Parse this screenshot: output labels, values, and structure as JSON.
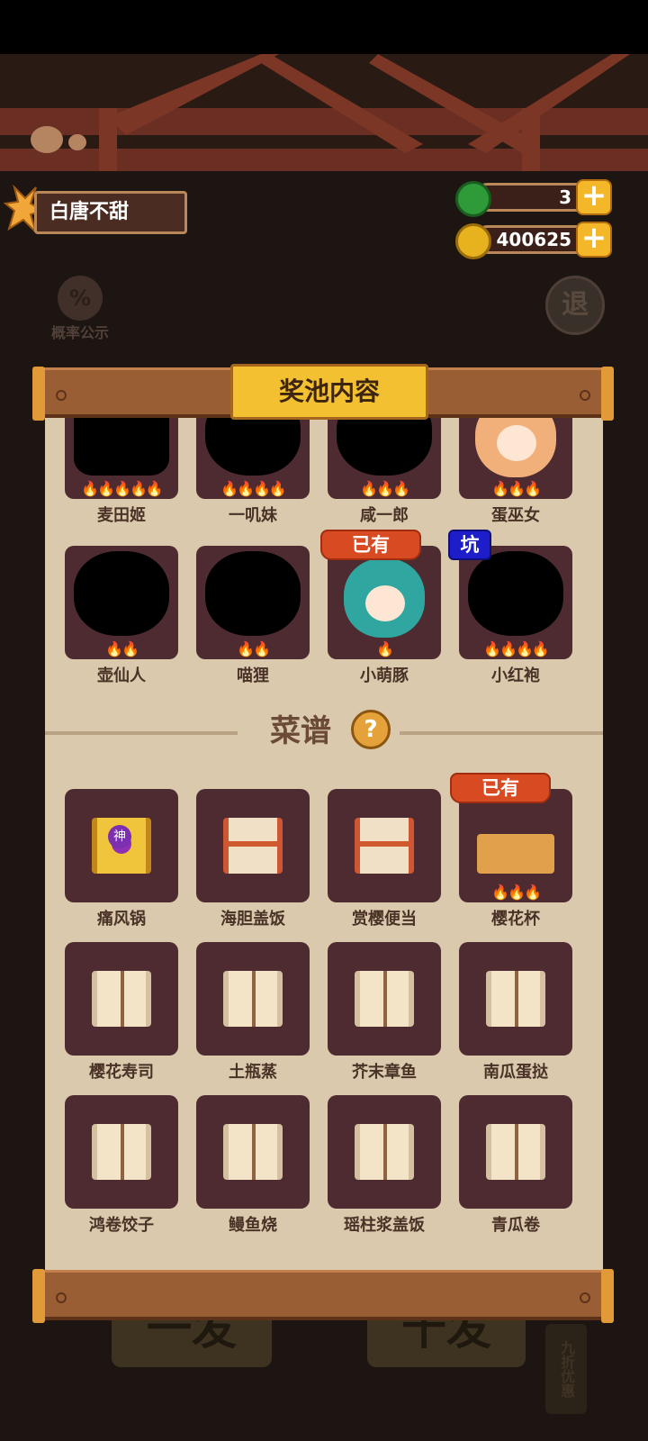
{
  "header": {
    "username": "白唐不甜",
    "jade_count": "3",
    "coin_count": "400625",
    "plus_label": "+"
  },
  "left_buttons": {
    "probability_icon": "%",
    "probability_label": "概率公示"
  },
  "exit_button": {
    "label": "退"
  },
  "panel": {
    "title": "奖池内容",
    "characters": [
      {
        "name": "麦田姬",
        "flames": "🔥🔥🔥🔥🔥",
        "owned": false,
        "silhouette": true
      },
      {
        "name": "一叽妹",
        "flames": "🔥🔥🔥🔥",
        "owned": false,
        "silhouette": true
      },
      {
        "name": "咸一郎",
        "flames": "🔥🔥🔥",
        "owned": false,
        "silhouette": true
      },
      {
        "name": "蛋巫女",
        "flames": "🔥🔥🔥",
        "owned": false,
        "silhouette": false
      },
      {
        "name": "壶仙人",
        "flames": "🔥🔥",
        "owned": false,
        "silhouette": true
      },
      {
        "name": "喵狸",
        "flames": "🔥🔥",
        "owned": false,
        "silhouette": true
      },
      {
        "name": "小萌豚",
        "flames": "🔥",
        "owned": true,
        "silhouette": false
      },
      {
        "name": "小红袍",
        "flames": "🔥🔥🔥🔥",
        "owned": false,
        "silhouette": true
      }
    ],
    "owned_badge": "已有",
    "pit_badge": "坑",
    "recipes_title": "菜谱",
    "help_icon": "?",
    "recipes": [
      {
        "name": "痛风锅",
        "style": "gold",
        "badge": "神"
      },
      {
        "name": "海胆盖饭",
        "style": "red"
      },
      {
        "name": "赏樱便当",
        "style": "red"
      },
      {
        "name": "樱花杯",
        "style": "dish",
        "flames": "🔥🔥🔥"
      },
      {
        "name": "樱花寿司",
        "style": "plain"
      },
      {
        "name": "土瓶蒸",
        "style": "plain"
      },
      {
        "name": "芥末章鱼",
        "style": "plain"
      },
      {
        "name": "南瓜蛋挞",
        "style": "plain"
      },
      {
        "name": "鸿卷饺子",
        "style": "plain"
      },
      {
        "name": "鳗鱼烧",
        "style": "plain"
      },
      {
        "name": "瑶柱浆盖饭",
        "style": "plain"
      },
      {
        "name": "青瓜卷",
        "style": "plain"
      }
    ]
  },
  "bottom": {
    "draw_one": "一发",
    "draw_ten": "十发",
    "discount": "九折优惠"
  }
}
